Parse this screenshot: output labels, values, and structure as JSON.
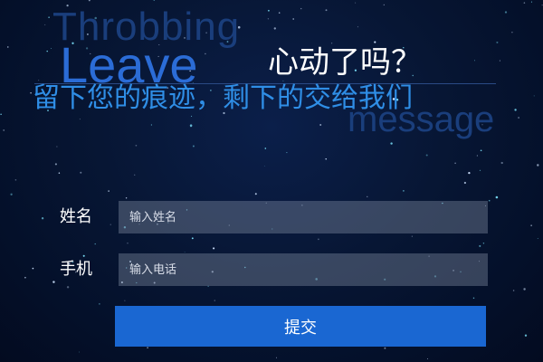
{
  "header": {
    "word_throbbing": "Throbbing",
    "word_leave": "Leave",
    "heart_question": "心动了吗？",
    "tagline": "留下您的痕迹，剩下的交给我们",
    "word_message": "message"
  },
  "form": {
    "name_label": "姓名",
    "name_placeholder": "输入姓名",
    "phone_label": "手机",
    "phone_placeholder": "输入电话",
    "submit_label": "提交"
  }
}
